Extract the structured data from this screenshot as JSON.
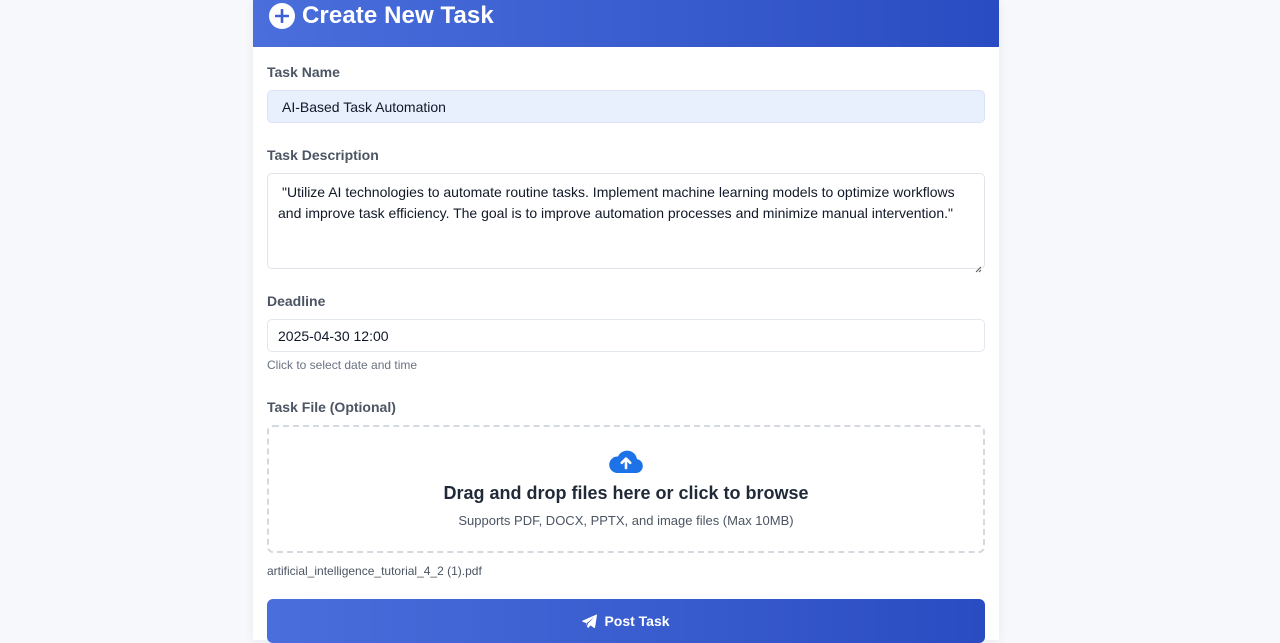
{
  "header": {
    "title": "Create New Task",
    "icon": "plus-circle-icon"
  },
  "form": {
    "task_name": {
      "label": "Task Name",
      "value": "AI-Based Task Automation"
    },
    "task_description": {
      "label": "Task Description",
      "value": "\"Utilize AI technologies to automate routine tasks. Implement machine learning models to optimize workflows and improve task efficiency. The goal is to improve automation processes and minimize manual intervention.\""
    },
    "deadline": {
      "label": "Deadline",
      "value": "2025-04-30 12:00",
      "hint": "Click to select date and time"
    },
    "task_file": {
      "label": "Task File (Optional)",
      "dropzone_title": "Drag and drop files here or click to browse",
      "dropzone_subtitle": "Supports PDF, DOCX, PPTX, and image files (Max 10MB)",
      "icon": "cloud-upload-icon",
      "selected_file": "artificial_intelligence_tutorial_4_2 (1).pdf"
    },
    "submit": {
      "label": "Post Task",
      "icon": "paper-plane-icon"
    }
  },
  "colors": {
    "accent_start": "#4a6fdc",
    "accent_end": "#2a4cc2",
    "upload_icon": "#1d72e8"
  }
}
